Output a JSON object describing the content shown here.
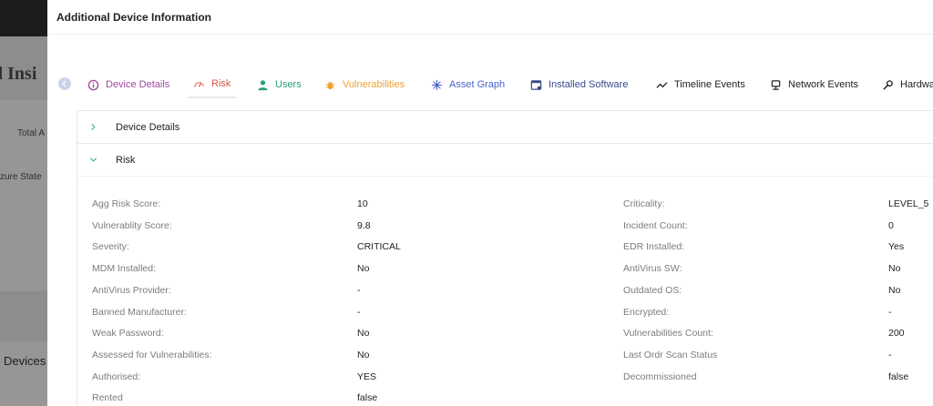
{
  "background": {
    "title": "d Insi",
    "label1": "Total A",
    "label2": "zure State",
    "devices": "Devices"
  },
  "modal": {
    "title": "Additional Device Information"
  },
  "tabs": [
    {
      "label": "Device Details",
      "icon": "info-circle-icon",
      "color": "#a0479e"
    },
    {
      "label": "Risk",
      "icon": "gauge-icon",
      "color": "#d9534f"
    },
    {
      "label": "Users",
      "icon": "user-icon",
      "color": "#2a9d7a"
    },
    {
      "label": "Vulnerabilities",
      "icon": "bug-icon",
      "color": "#f0a030"
    },
    {
      "label": "Asset Graph",
      "icon": "network-icon",
      "color": "#4a63c9"
    },
    {
      "label": "Installed Software",
      "icon": "window-icon",
      "color": "#3a4a8a"
    },
    {
      "label": "Timeline Events",
      "icon": "trend-icon",
      "color": "#222222"
    },
    {
      "label": "Network Events",
      "icon": "monitor-icon",
      "color": "#222222"
    },
    {
      "label": "Hardwa",
      "icon": "wrench-icon",
      "color": "#222222"
    }
  ],
  "accordion": {
    "device_details": "Device Details",
    "risk": "Risk"
  },
  "left_fields": [
    {
      "label": "Agg Risk Score:",
      "value": "10"
    },
    {
      "label": "Vulnerablity Score:",
      "value": "9.8"
    },
    {
      "label": "Severity:",
      "value": "CRITICAL"
    },
    {
      "label": "MDM Installed:",
      "value": "No"
    },
    {
      "label": "AntiVirus Provider:",
      "value": "-"
    },
    {
      "label": "Banned Manufacturer:",
      "value": "-"
    },
    {
      "label": "Weak Password:",
      "value": "No"
    },
    {
      "label": "Assessed for Vulnerabilities:",
      "value": "No"
    },
    {
      "label": "Authorised:",
      "value": "YES"
    },
    {
      "label": "Rented",
      "value": "false"
    }
  ],
  "right_fields": [
    {
      "label": "Criticality:",
      "value": "LEVEL_5"
    },
    {
      "label": "Incident Count:",
      "value": "0"
    },
    {
      "label": "EDR Installed:",
      "value": "Yes"
    },
    {
      "label": "AntiVirus SW:",
      "value": "No"
    },
    {
      "label": "Outdated OS:",
      "value": "No"
    },
    {
      "label": "Encrypted:",
      "value": "-"
    },
    {
      "label": "Vulnerabilities Count:",
      "value": "200"
    },
    {
      "label": "Last Ordr Scan Status",
      "value": "-"
    },
    {
      "label": "Decommissioned",
      "value": "false"
    }
  ]
}
